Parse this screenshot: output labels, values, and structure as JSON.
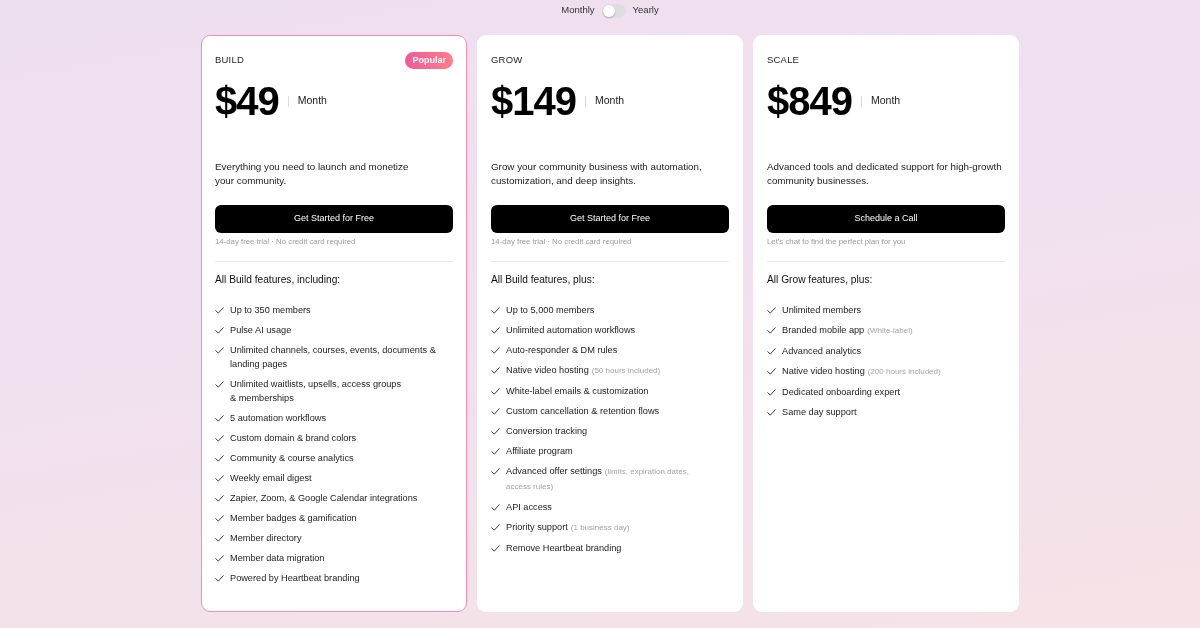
{
  "billing_toggle": {
    "left_label": "Monthly",
    "right_label": "Yearly",
    "on": false
  },
  "plans": [
    {
      "name": "BUILD",
      "badge": "Popular",
      "highlighted": true,
      "price": "$49",
      "period": "Month",
      "description": "Everything you need to launch and monetize\nyour community.",
      "button": "Get Started for Free",
      "footnote": "14-day free trial · No credit card required",
      "features_heading": "All Build features, including:",
      "features": [
        {
          "text": "Up to 350 members"
        },
        {
          "text": "Pulse AI usage"
        },
        {
          "text": "Unlimited channels, courses, events, documents & landing pages"
        },
        {
          "text": "Unlimited waitlists, upsells, access groups\n& memberships"
        },
        {
          "text": "5 automation workflows"
        },
        {
          "text": "Custom domain & brand colors"
        },
        {
          "text": "Community & course analytics"
        },
        {
          "text": "Weekly email digest"
        },
        {
          "text": "Zapier, Zoom, & Google Calendar integrations"
        },
        {
          "text": "Member badges & gamification"
        },
        {
          "text": "Member directory"
        },
        {
          "text": "Member data migration"
        },
        {
          "text": "Powered by Heartbeat branding"
        }
      ]
    },
    {
      "name": "GROW",
      "highlighted": false,
      "price": "$149",
      "period": "Month",
      "description": "Grow your community business with automation, customization, and deep insights.",
      "button": "Get Started for Free",
      "footnote": "14-day free trial · No credit card required",
      "features_heading": "All Build features, plus:",
      "features": [
        {
          "text": "Up to 5,000 members"
        },
        {
          "text": "Unlimited automation workflows"
        },
        {
          "text": "Auto-responder & DM rules"
        },
        {
          "text": "Native video hosting",
          "note": "(50 hours included)"
        },
        {
          "text": "White-label emails & customization"
        },
        {
          "text": "Custom cancellation & retention flows"
        },
        {
          "text": "Conversion tracking"
        },
        {
          "text": "Affiliate program"
        },
        {
          "text": "Advanced offer settings",
          "note": "(limits, expiration dates, access rules)"
        },
        {
          "text": "API access"
        },
        {
          "text": "Priority support",
          "note": "(1 business day)"
        },
        {
          "text": "Remove Heartbeat branding"
        }
      ]
    },
    {
      "name": "SCALE",
      "highlighted": false,
      "price": "$849",
      "period": "Month",
      "description": "Advanced tools and dedicated support for high-growth community businesses.",
      "button": "Schedule a Call",
      "footnote": "Let's chat to find the perfect plan for you",
      "features_heading": "All Grow features, plus:",
      "features": [
        {
          "text": "Unlimited members"
        },
        {
          "text": "Branded mobile app",
          "note": "(White-label)"
        },
        {
          "text": "Advanced analytics"
        },
        {
          "text": "Native video hosting",
          "note": "(200 hours included)"
        },
        {
          "text": "Dedicated onboarding expert"
        },
        {
          "text": "Same day support"
        }
      ]
    }
  ]
}
